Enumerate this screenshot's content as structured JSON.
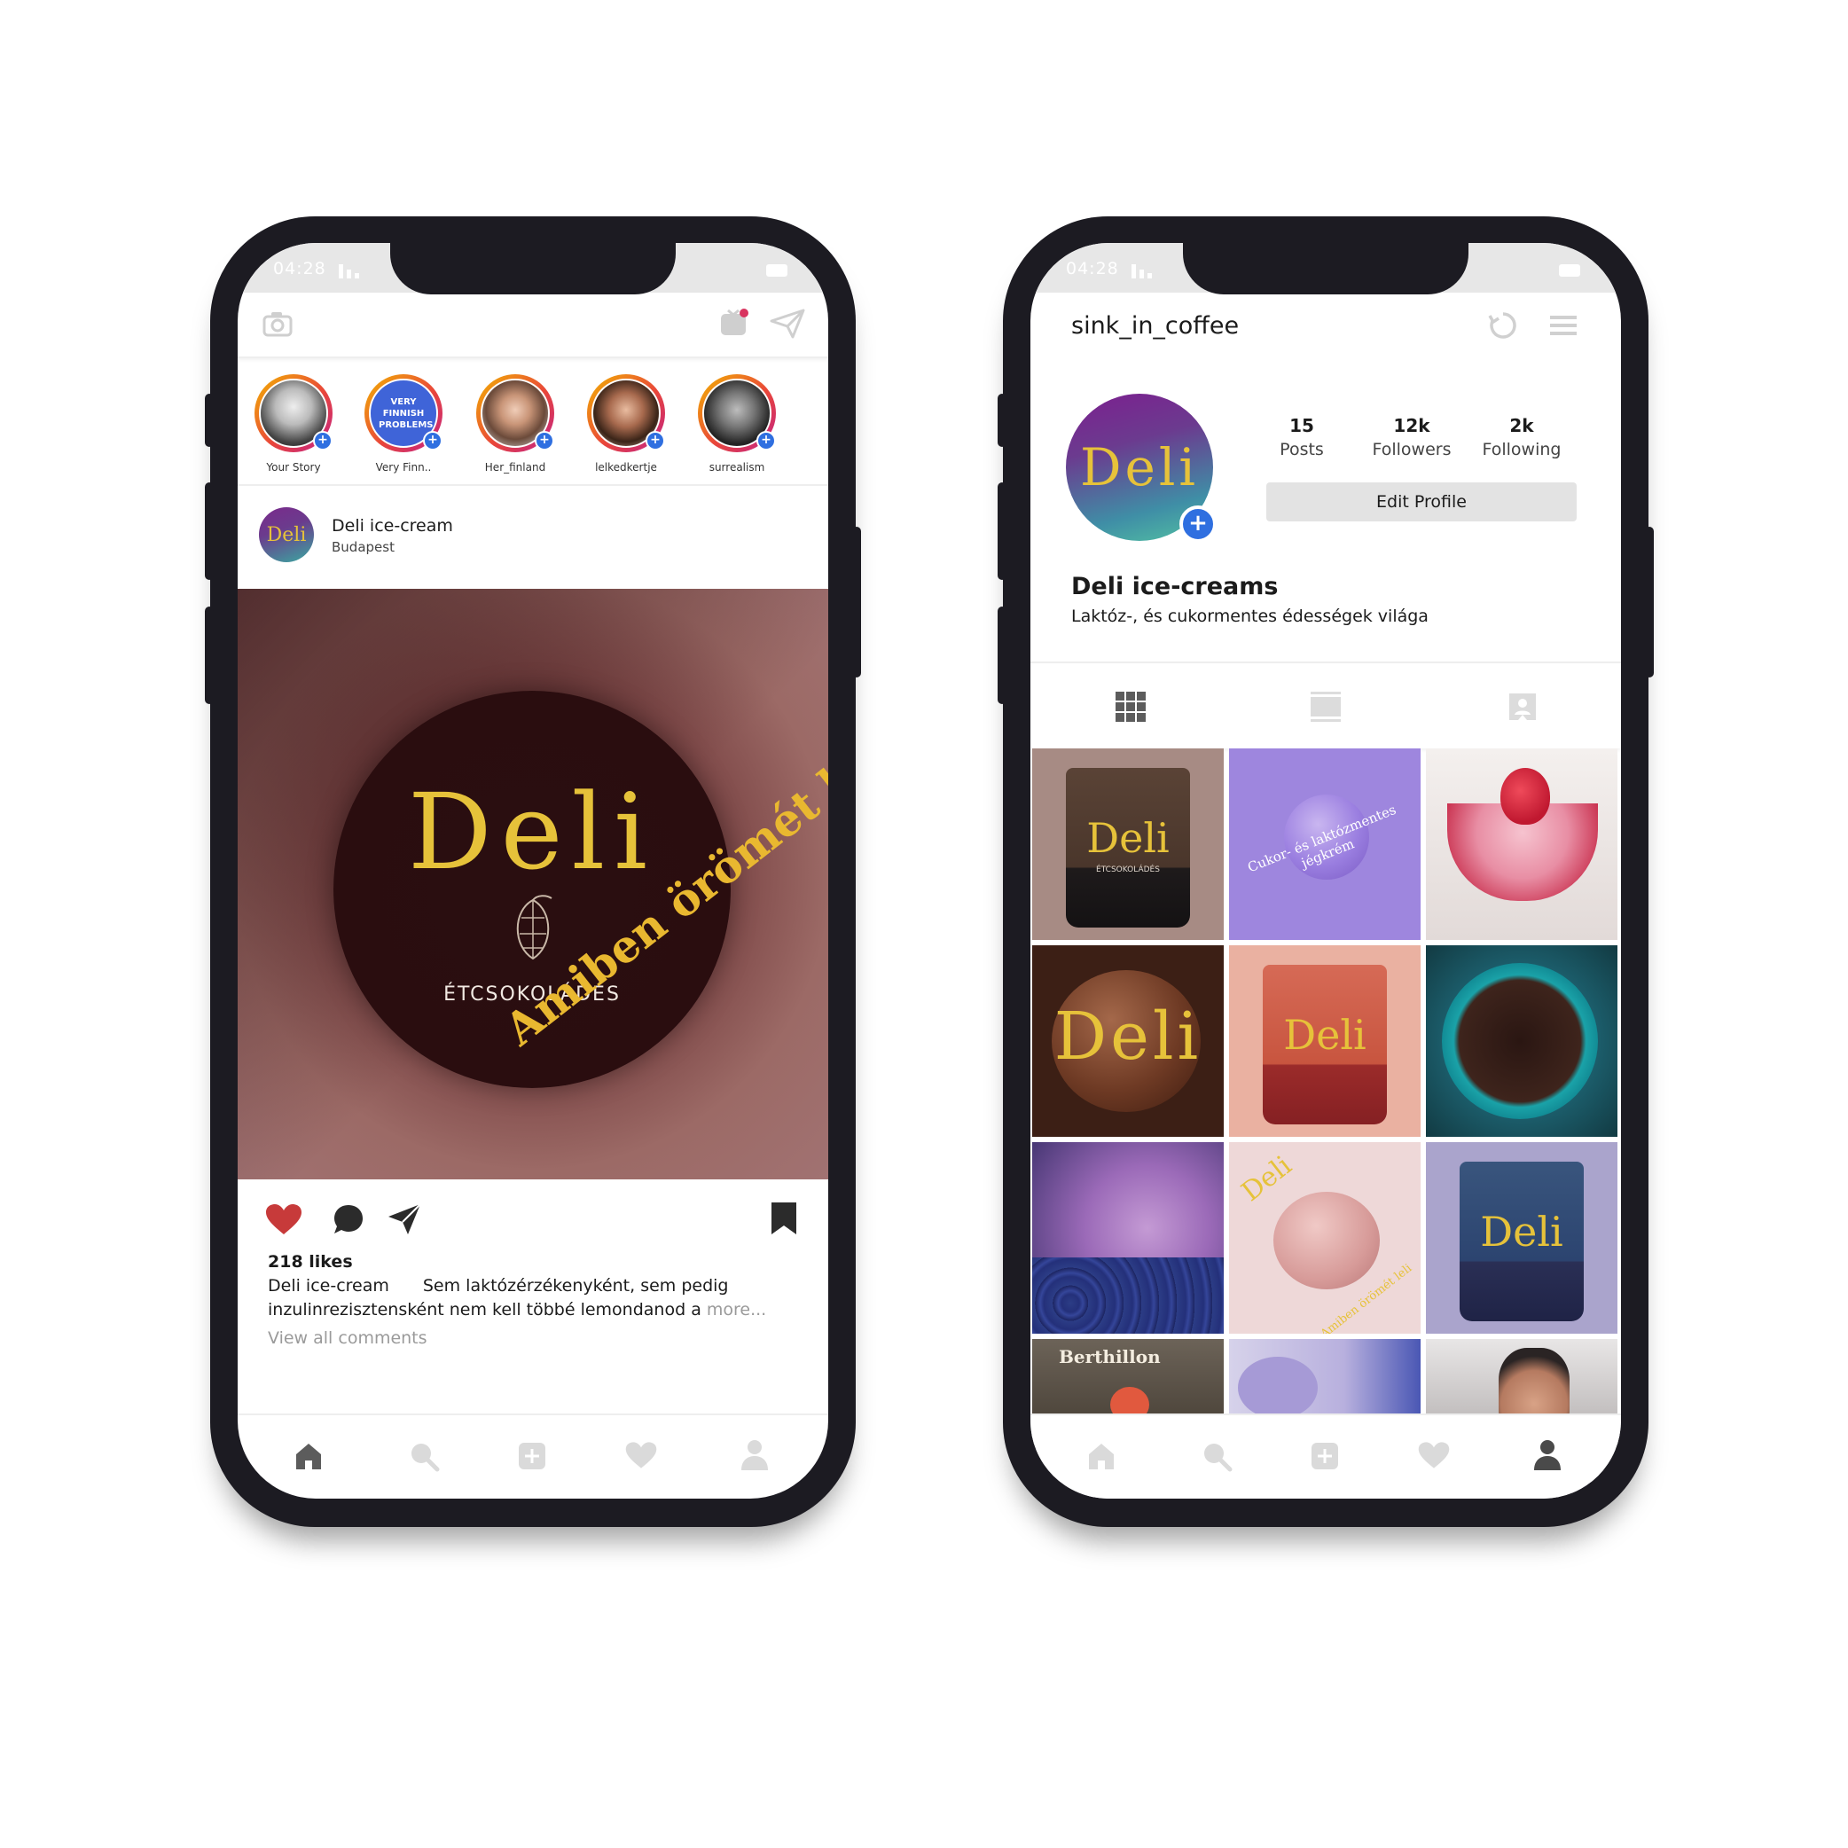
{
  "colors": {
    "accent_blue": "#2f6fe0",
    "like_red": "#c73a3a",
    "gold": "#e6c23a",
    "frame": "#1c1b22"
  },
  "left": {
    "status_time": "04:28",
    "stories": [
      {
        "label": "Your Story"
      },
      {
        "label": "Very Finn..",
        "art": "VERY FINNISH PROBLEMS"
      },
      {
        "label": "Her_finland"
      },
      {
        "label": "lelkedkertje"
      },
      {
        "label": "surrealism"
      }
    ],
    "post": {
      "account": "Deli ice-cream",
      "location": "Budapest",
      "image_brand": "Deli",
      "image_flavor": "ÉTCSOKOLÁDÉS",
      "image_slogan": "Amiben örömét leli",
      "likes": "218 likes",
      "caption_user": "Deli ice-cream",
      "caption_text": "Sem laktózérzékenyként, sem pedig",
      "caption_text2": "inzulinrezisztensként nem kell többé lemondanod a",
      "more": "more...",
      "view_comments": "View all comments"
    }
  },
  "right": {
    "status_time": "04:28",
    "username": "sink_in_coffee",
    "avatar_text": "Deli",
    "stats": [
      {
        "value": "15",
        "label": "Posts"
      },
      {
        "value": "12k",
        "label": "Followers"
      },
      {
        "value": "2k",
        "label": "Following"
      }
    ],
    "edit_profile": "Edit Profile",
    "display_name": "Deli ice-creams",
    "bio": "Laktóz-, és cukormentes édességek világa",
    "tiles": {
      "t1_label": "Deli",
      "t1_small": "ÉTCSOKOLÁDÉS",
      "t2_text": "Cukor- és laktózmentes jégkrém",
      "t4_label": "Deli",
      "t5_label": "Deli",
      "t8_brand": "Deli",
      "t8_slogan": "Amiben örömét leli",
      "t9_label": "Deli",
      "t10_sign": "Berthillon"
    }
  }
}
